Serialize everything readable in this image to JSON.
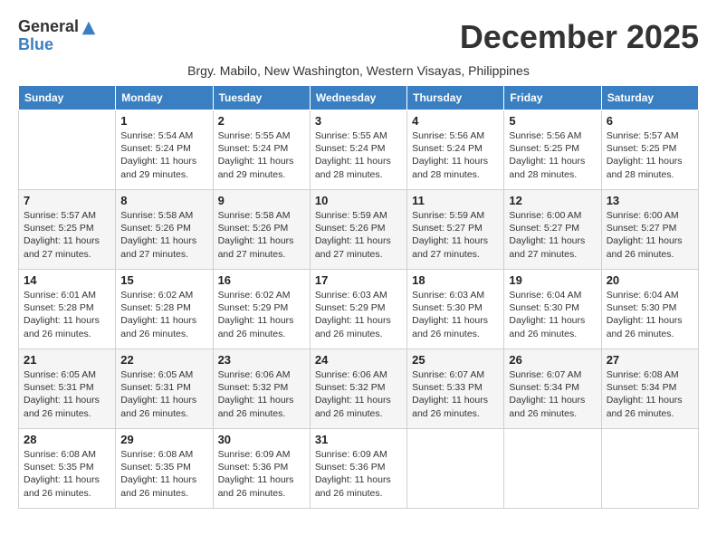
{
  "header": {
    "logo_general": "General",
    "logo_blue": "Blue",
    "month": "December 2025",
    "subtitle": "Brgy. Mabilo, New Washington, Western Visayas, Philippines"
  },
  "weekdays": [
    "Sunday",
    "Monday",
    "Tuesday",
    "Wednesday",
    "Thursday",
    "Friday",
    "Saturday"
  ],
  "weeks": [
    [
      {
        "day": "",
        "sunrise": "",
        "sunset": "",
        "daylight": ""
      },
      {
        "day": "1",
        "sunrise": "Sunrise: 5:54 AM",
        "sunset": "Sunset: 5:24 PM",
        "daylight": "Daylight: 11 hours and 29 minutes."
      },
      {
        "day": "2",
        "sunrise": "Sunrise: 5:55 AM",
        "sunset": "Sunset: 5:24 PM",
        "daylight": "Daylight: 11 hours and 29 minutes."
      },
      {
        "day": "3",
        "sunrise": "Sunrise: 5:55 AM",
        "sunset": "Sunset: 5:24 PM",
        "daylight": "Daylight: 11 hours and 28 minutes."
      },
      {
        "day": "4",
        "sunrise": "Sunrise: 5:56 AM",
        "sunset": "Sunset: 5:24 PM",
        "daylight": "Daylight: 11 hours and 28 minutes."
      },
      {
        "day": "5",
        "sunrise": "Sunrise: 5:56 AM",
        "sunset": "Sunset: 5:25 PM",
        "daylight": "Daylight: 11 hours and 28 minutes."
      },
      {
        "day": "6",
        "sunrise": "Sunrise: 5:57 AM",
        "sunset": "Sunset: 5:25 PM",
        "daylight": "Daylight: 11 hours and 28 minutes."
      }
    ],
    [
      {
        "day": "7",
        "sunrise": "Sunrise: 5:57 AM",
        "sunset": "Sunset: 5:25 PM",
        "daylight": "Daylight: 11 hours and 27 minutes."
      },
      {
        "day": "8",
        "sunrise": "Sunrise: 5:58 AM",
        "sunset": "Sunset: 5:26 PM",
        "daylight": "Daylight: 11 hours and 27 minutes."
      },
      {
        "day": "9",
        "sunrise": "Sunrise: 5:58 AM",
        "sunset": "Sunset: 5:26 PM",
        "daylight": "Daylight: 11 hours and 27 minutes."
      },
      {
        "day": "10",
        "sunrise": "Sunrise: 5:59 AM",
        "sunset": "Sunset: 5:26 PM",
        "daylight": "Daylight: 11 hours and 27 minutes."
      },
      {
        "day": "11",
        "sunrise": "Sunrise: 5:59 AM",
        "sunset": "Sunset: 5:27 PM",
        "daylight": "Daylight: 11 hours and 27 minutes."
      },
      {
        "day": "12",
        "sunrise": "Sunrise: 6:00 AM",
        "sunset": "Sunset: 5:27 PM",
        "daylight": "Daylight: 11 hours and 27 minutes."
      },
      {
        "day": "13",
        "sunrise": "Sunrise: 6:00 AM",
        "sunset": "Sunset: 5:27 PM",
        "daylight": "Daylight: 11 hours and 26 minutes."
      }
    ],
    [
      {
        "day": "14",
        "sunrise": "Sunrise: 6:01 AM",
        "sunset": "Sunset: 5:28 PM",
        "daylight": "Daylight: 11 hours and 26 minutes."
      },
      {
        "day": "15",
        "sunrise": "Sunrise: 6:02 AM",
        "sunset": "Sunset: 5:28 PM",
        "daylight": "Daylight: 11 hours and 26 minutes."
      },
      {
        "day": "16",
        "sunrise": "Sunrise: 6:02 AM",
        "sunset": "Sunset: 5:29 PM",
        "daylight": "Daylight: 11 hours and 26 minutes."
      },
      {
        "day": "17",
        "sunrise": "Sunrise: 6:03 AM",
        "sunset": "Sunset: 5:29 PM",
        "daylight": "Daylight: 11 hours and 26 minutes."
      },
      {
        "day": "18",
        "sunrise": "Sunrise: 6:03 AM",
        "sunset": "Sunset: 5:30 PM",
        "daylight": "Daylight: 11 hours and 26 minutes."
      },
      {
        "day": "19",
        "sunrise": "Sunrise: 6:04 AM",
        "sunset": "Sunset: 5:30 PM",
        "daylight": "Daylight: 11 hours and 26 minutes."
      },
      {
        "day": "20",
        "sunrise": "Sunrise: 6:04 AM",
        "sunset": "Sunset: 5:30 PM",
        "daylight": "Daylight: 11 hours and 26 minutes."
      }
    ],
    [
      {
        "day": "21",
        "sunrise": "Sunrise: 6:05 AM",
        "sunset": "Sunset: 5:31 PM",
        "daylight": "Daylight: 11 hours and 26 minutes."
      },
      {
        "day": "22",
        "sunrise": "Sunrise: 6:05 AM",
        "sunset": "Sunset: 5:31 PM",
        "daylight": "Daylight: 11 hours and 26 minutes."
      },
      {
        "day": "23",
        "sunrise": "Sunrise: 6:06 AM",
        "sunset": "Sunset: 5:32 PM",
        "daylight": "Daylight: 11 hours and 26 minutes."
      },
      {
        "day": "24",
        "sunrise": "Sunrise: 6:06 AM",
        "sunset": "Sunset: 5:32 PM",
        "daylight": "Daylight: 11 hours and 26 minutes."
      },
      {
        "day": "25",
        "sunrise": "Sunrise: 6:07 AM",
        "sunset": "Sunset: 5:33 PM",
        "daylight": "Daylight: 11 hours and 26 minutes."
      },
      {
        "day": "26",
        "sunrise": "Sunrise: 6:07 AM",
        "sunset": "Sunset: 5:34 PM",
        "daylight": "Daylight: 11 hours and 26 minutes."
      },
      {
        "day": "27",
        "sunrise": "Sunrise: 6:08 AM",
        "sunset": "Sunset: 5:34 PM",
        "daylight": "Daylight: 11 hours and 26 minutes."
      }
    ],
    [
      {
        "day": "28",
        "sunrise": "Sunrise: 6:08 AM",
        "sunset": "Sunset: 5:35 PM",
        "daylight": "Daylight: 11 hours and 26 minutes."
      },
      {
        "day": "29",
        "sunrise": "Sunrise: 6:08 AM",
        "sunset": "Sunset: 5:35 PM",
        "daylight": "Daylight: 11 hours and 26 minutes."
      },
      {
        "day": "30",
        "sunrise": "Sunrise: 6:09 AM",
        "sunset": "Sunset: 5:36 PM",
        "daylight": "Daylight: 11 hours and 26 minutes."
      },
      {
        "day": "31",
        "sunrise": "Sunrise: 6:09 AM",
        "sunset": "Sunset: 5:36 PM",
        "daylight": "Daylight: 11 hours and 26 minutes."
      },
      {
        "day": "",
        "sunrise": "",
        "sunset": "",
        "daylight": ""
      },
      {
        "day": "",
        "sunrise": "",
        "sunset": "",
        "daylight": ""
      },
      {
        "day": "",
        "sunrise": "",
        "sunset": "",
        "daylight": ""
      }
    ]
  ]
}
